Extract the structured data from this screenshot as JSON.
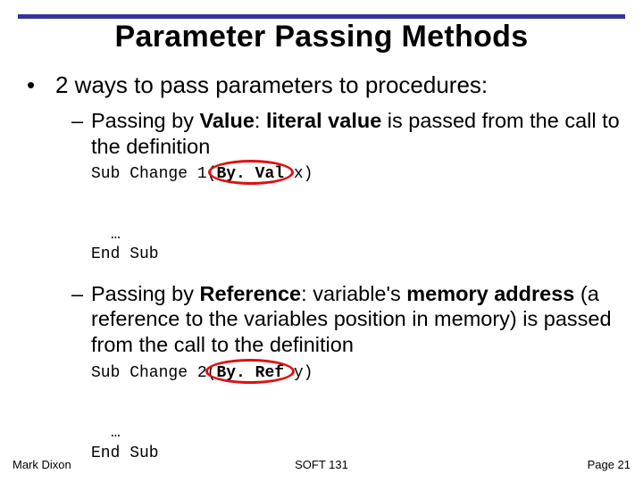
{
  "title": "Parameter Passing Methods",
  "intro": "2 ways to pass parameters to procedures:",
  "byValue": {
    "label_lead": "Passing by ",
    "label_bold": "Value",
    "mid": ": ",
    "emph": "literal value",
    "rest": " is passed from the call to the definition",
    "code": {
      "l1_a": "Sub Change 1(",
      "kw": "By. Val",
      "l1_b": " x)",
      "l2": "…",
      "l3": "End Sub"
    }
  },
  "byRef": {
    "label_lead": "Passing by ",
    "label_bold": "Reference",
    "mid": ": variable's ",
    "emph": "memory address",
    "rest": " (a reference to the variables position in memory) is passed from the call to the definition",
    "code": {
      "l1_a": "Sub Change 2(",
      "kw": "By. Ref",
      "l1_b": " y)",
      "l2": "…",
      "l3": "End Sub"
    }
  },
  "footer": {
    "author": "Mark Dixon",
    "course": "SOFT 131",
    "page": "Page 21"
  }
}
